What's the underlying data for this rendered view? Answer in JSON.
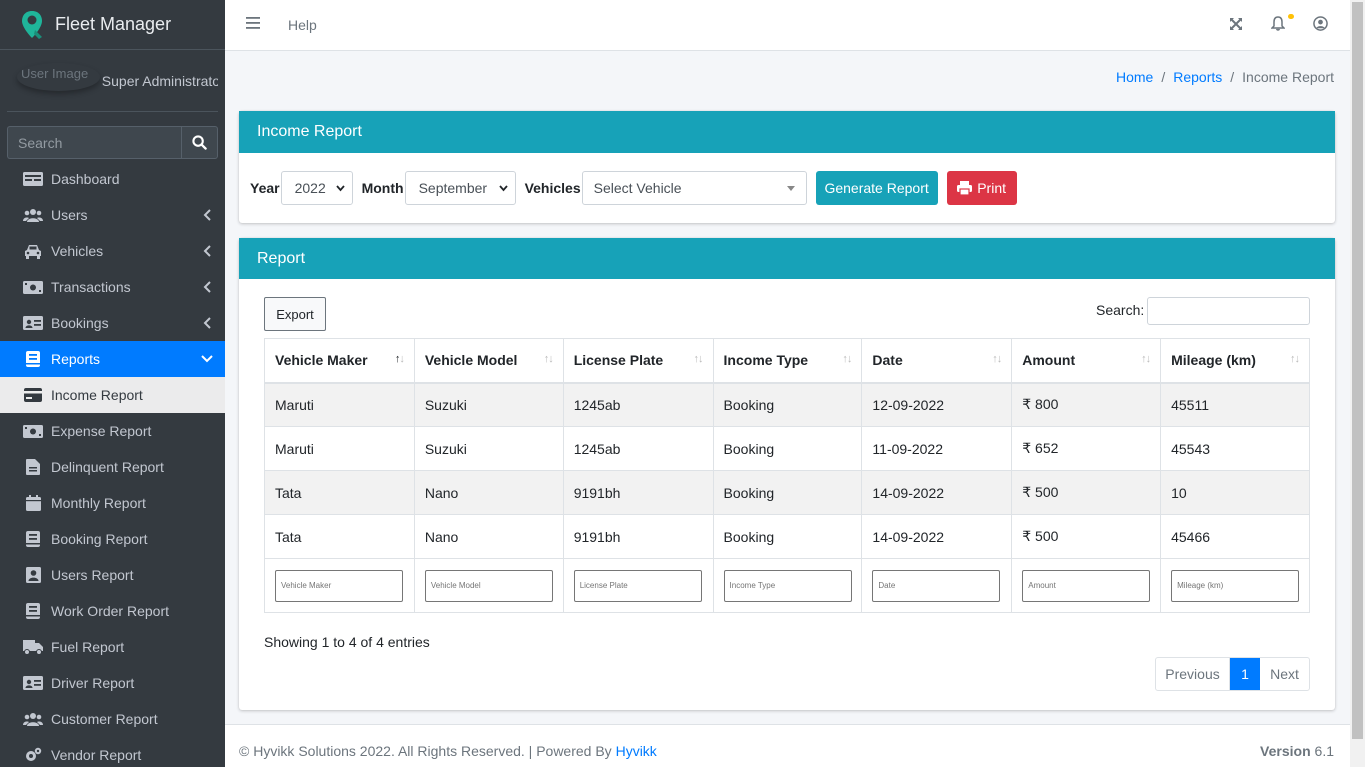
{
  "brand": {
    "name": "Fleet Manager"
  },
  "user": {
    "image_alt": "User Image",
    "name": "Super Administrator"
  },
  "sidebar_search": {
    "placeholder": "Search"
  },
  "nav": {
    "dashboard": "Dashboard",
    "users": "Users",
    "vehicles": "Vehicles",
    "transactions": "Transactions",
    "bookings": "Bookings",
    "reports": "Reports",
    "sub": {
      "income": "Income Report",
      "expense": "Expense Report",
      "delinquent": "Delinquent Report",
      "monthly": "Monthly Report",
      "booking": "Booking Report",
      "users": "Users Report",
      "work_order": "Work Order Report",
      "fuel": "Fuel Report",
      "driver": "Driver Report",
      "customer": "Customer Report",
      "vendor": "Vendor Report"
    }
  },
  "topbar": {
    "help": "Help"
  },
  "breadcrumb": {
    "home": "Home",
    "sep": "/",
    "reports": "Reports",
    "current": "Income Report"
  },
  "income_card": {
    "title": "Income Report",
    "year_label": "Year",
    "year_value": "2022",
    "month_label": "Month",
    "month_value": "September",
    "vehicles_label": "Vehicles",
    "vehicle_placeholder": "Select Vehicle",
    "generate_label": "Generate Report",
    "print_label": "Print"
  },
  "report_card": {
    "title": "Report",
    "export_label": "Export",
    "search_label": "Search:",
    "columns": [
      "Vehicle Maker",
      "Vehicle Model",
      "License Plate",
      "Income Type",
      "Date",
      "Amount",
      "Mileage (km)"
    ],
    "rows": [
      [
        "Maruti",
        "Suzuki",
        "1245ab",
        "Booking",
        "12-09-2022",
        "₹ 800",
        "45511"
      ],
      [
        "Maruti",
        "Suzuki",
        "1245ab",
        "Booking",
        "11-09-2022",
        "₹ 652",
        "45543"
      ],
      [
        "Tata",
        "Nano",
        "9191bh",
        "Booking",
        "14-09-2022",
        "₹ 500",
        "10"
      ],
      [
        "Tata",
        "Nano",
        "9191bh",
        "Booking",
        "14-09-2022",
        "₹ 500",
        "45466"
      ]
    ],
    "info": "Showing 1 to 4 of 4 entries",
    "pager": {
      "previous": "Previous",
      "page": "1",
      "next": "Next"
    }
  },
  "footer": {
    "copyright": "© Hyvikk Solutions 2022. All Rights Reserved. | Powered By ",
    "link": "Hyvikk",
    "version_label": "Version",
    "version": "6.1"
  },
  "colors": {
    "accent": "#17a2b8",
    "primary": "#007bff",
    "danger": "#dc3545",
    "sidebar": "#343a40"
  }
}
